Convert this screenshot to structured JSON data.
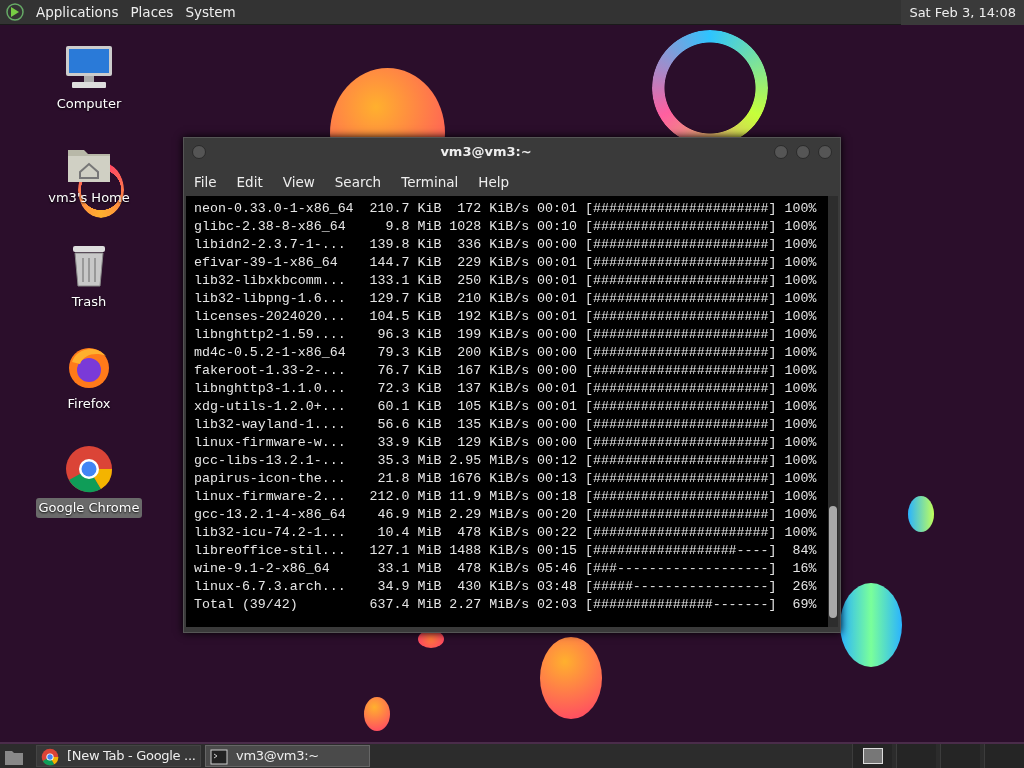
{
  "top_panel": {
    "menus": [
      "Applications",
      "Places",
      "System"
    ],
    "clock": "Sat Feb  3, 14:08"
  },
  "desktop_icons": [
    {
      "kind": "computer",
      "label": "Computer",
      "selected": false
    },
    {
      "kind": "home",
      "label": "vm3's Home",
      "selected": false
    },
    {
      "kind": "trash",
      "label": "Trash",
      "selected": false
    },
    {
      "kind": "firefox",
      "label": "Firefox",
      "selected": false
    },
    {
      "kind": "chrome",
      "label": "Google Chrome",
      "selected": true
    }
  ],
  "window": {
    "title": "vm3@vm3:~",
    "menu": [
      "File",
      "Edit",
      "View",
      "Search",
      "Terminal",
      "Help"
    ],
    "lines": [
      {
        "name": "neon-0.33.0-1-x86_64",
        "size": "210.7 KiB",
        "speed": "172 KiB/s",
        "time": "00:01",
        "bar": "[######################]",
        "percent": "100%"
      },
      {
        "name": "glibc-2.38-8-x86_64",
        "size": "9.8 MiB",
        "speed": "1028 KiB/s",
        "time": "00:10",
        "bar": "[######################]",
        "percent": "100%"
      },
      {
        "name": "libidn2-2.3.7-1-...",
        "size": "139.8 KiB",
        "speed": "336 KiB/s",
        "time": "00:00",
        "bar": "[######################]",
        "percent": "100%"
      },
      {
        "name": "efivar-39-1-x86_64",
        "size": "144.7 KiB",
        "speed": "229 KiB/s",
        "time": "00:01",
        "bar": "[######################]",
        "percent": "100%"
      },
      {
        "name": "lib32-libxkbcomm...",
        "size": "133.1 KiB",
        "speed": "250 KiB/s",
        "time": "00:01",
        "bar": "[######################]",
        "percent": "100%"
      },
      {
        "name": "lib32-libpng-1.6...",
        "size": "129.7 KiB",
        "speed": "210 KiB/s",
        "time": "00:01",
        "bar": "[######################]",
        "percent": "100%"
      },
      {
        "name": "licenses-2024020...",
        "size": "104.5 KiB",
        "speed": "192 KiB/s",
        "time": "00:01",
        "bar": "[######################]",
        "percent": "100%"
      },
      {
        "name": "libnghttp2-1.59....",
        "size": "96.3 KiB",
        "speed": "199 KiB/s",
        "time": "00:00",
        "bar": "[######################]",
        "percent": "100%"
      },
      {
        "name": "md4c-0.5.2-1-x86_64",
        "size": "79.3 KiB",
        "speed": "200 KiB/s",
        "time": "00:00",
        "bar": "[######################]",
        "percent": "100%"
      },
      {
        "name": "fakeroot-1.33-2-...",
        "size": "76.7 KiB",
        "speed": "167 KiB/s",
        "time": "00:00",
        "bar": "[######################]",
        "percent": "100%"
      },
      {
        "name": "libnghttp3-1.1.0...",
        "size": "72.3 KiB",
        "speed": "137 KiB/s",
        "time": "00:01",
        "bar": "[######################]",
        "percent": "100%"
      },
      {
        "name": "xdg-utils-1.2.0+...",
        "size": "60.1 KiB",
        "speed": "105 KiB/s",
        "time": "00:01",
        "bar": "[######################]",
        "percent": "100%"
      },
      {
        "name": "lib32-wayland-1....",
        "size": "56.6 KiB",
        "speed": "135 KiB/s",
        "time": "00:00",
        "bar": "[######################]",
        "percent": "100%"
      },
      {
        "name": "linux-firmware-w...",
        "size": "33.9 KiB",
        "speed": "129 KiB/s",
        "time": "00:00",
        "bar": "[######################]",
        "percent": "100%"
      },
      {
        "name": "gcc-libs-13.2.1-...",
        "size": "35.3 MiB",
        "speed": "2.95 MiB/s",
        "time": "00:12",
        "bar": "[######################]",
        "percent": "100%"
      },
      {
        "name": "papirus-icon-the...",
        "size": "21.8 MiB",
        "speed": "1676 KiB/s",
        "time": "00:13",
        "bar": "[######################]",
        "percent": "100%"
      },
      {
        "name": "linux-firmware-2...",
        "size": "212.0 MiB",
        "speed": "11.9 MiB/s",
        "time": "00:18",
        "bar": "[######################]",
        "percent": "100%"
      },
      {
        "name": "gcc-13.2.1-4-x86_64",
        "size": "46.9 MiB",
        "speed": "2.29 MiB/s",
        "time": "00:20",
        "bar": "[######################]",
        "percent": "100%"
      },
      {
        "name": "lib32-icu-74.2-1...",
        "size": "10.4 MiB",
        "speed": "478 KiB/s",
        "time": "00:22",
        "bar": "[######################]",
        "percent": "100%"
      },
      {
        "name": "libreoffice-stil...",
        "size": "127.1 MiB",
        "speed": "1488 KiB/s",
        "time": "00:15",
        "bar": "[##################----]",
        "percent": "84%"
      },
      {
        "name": "wine-9.1-2-x86_64",
        "size": "33.1 MiB",
        "speed": "478 KiB/s",
        "time": "05:46",
        "bar": "[###-------------------]",
        "percent": "16%"
      },
      {
        "name": "linux-6.7.3.arch...",
        "size": "34.9 MiB",
        "speed": "430 KiB/s",
        "time": "03:48",
        "bar": "[#####-----------------]",
        "percent": "26%"
      },
      {
        "name": "Total (39/42)",
        "size": "637.4 MiB",
        "speed": "2.27 MiB/s",
        "time": "02:03",
        "bar": "[###############-------]",
        "percent": "69%"
      }
    ]
  },
  "taskbar": {
    "tasks": [
      {
        "kind": "browser",
        "label": "[New Tab - Google ...",
        "selected": false
      },
      {
        "kind": "terminal",
        "label": "vm3@vm3:~",
        "selected": true
      }
    ],
    "workspaces": [
      {
        "selected": true
      },
      {
        "selected": false
      },
      {
        "selected": false
      },
      {
        "selected": false
      }
    ]
  }
}
